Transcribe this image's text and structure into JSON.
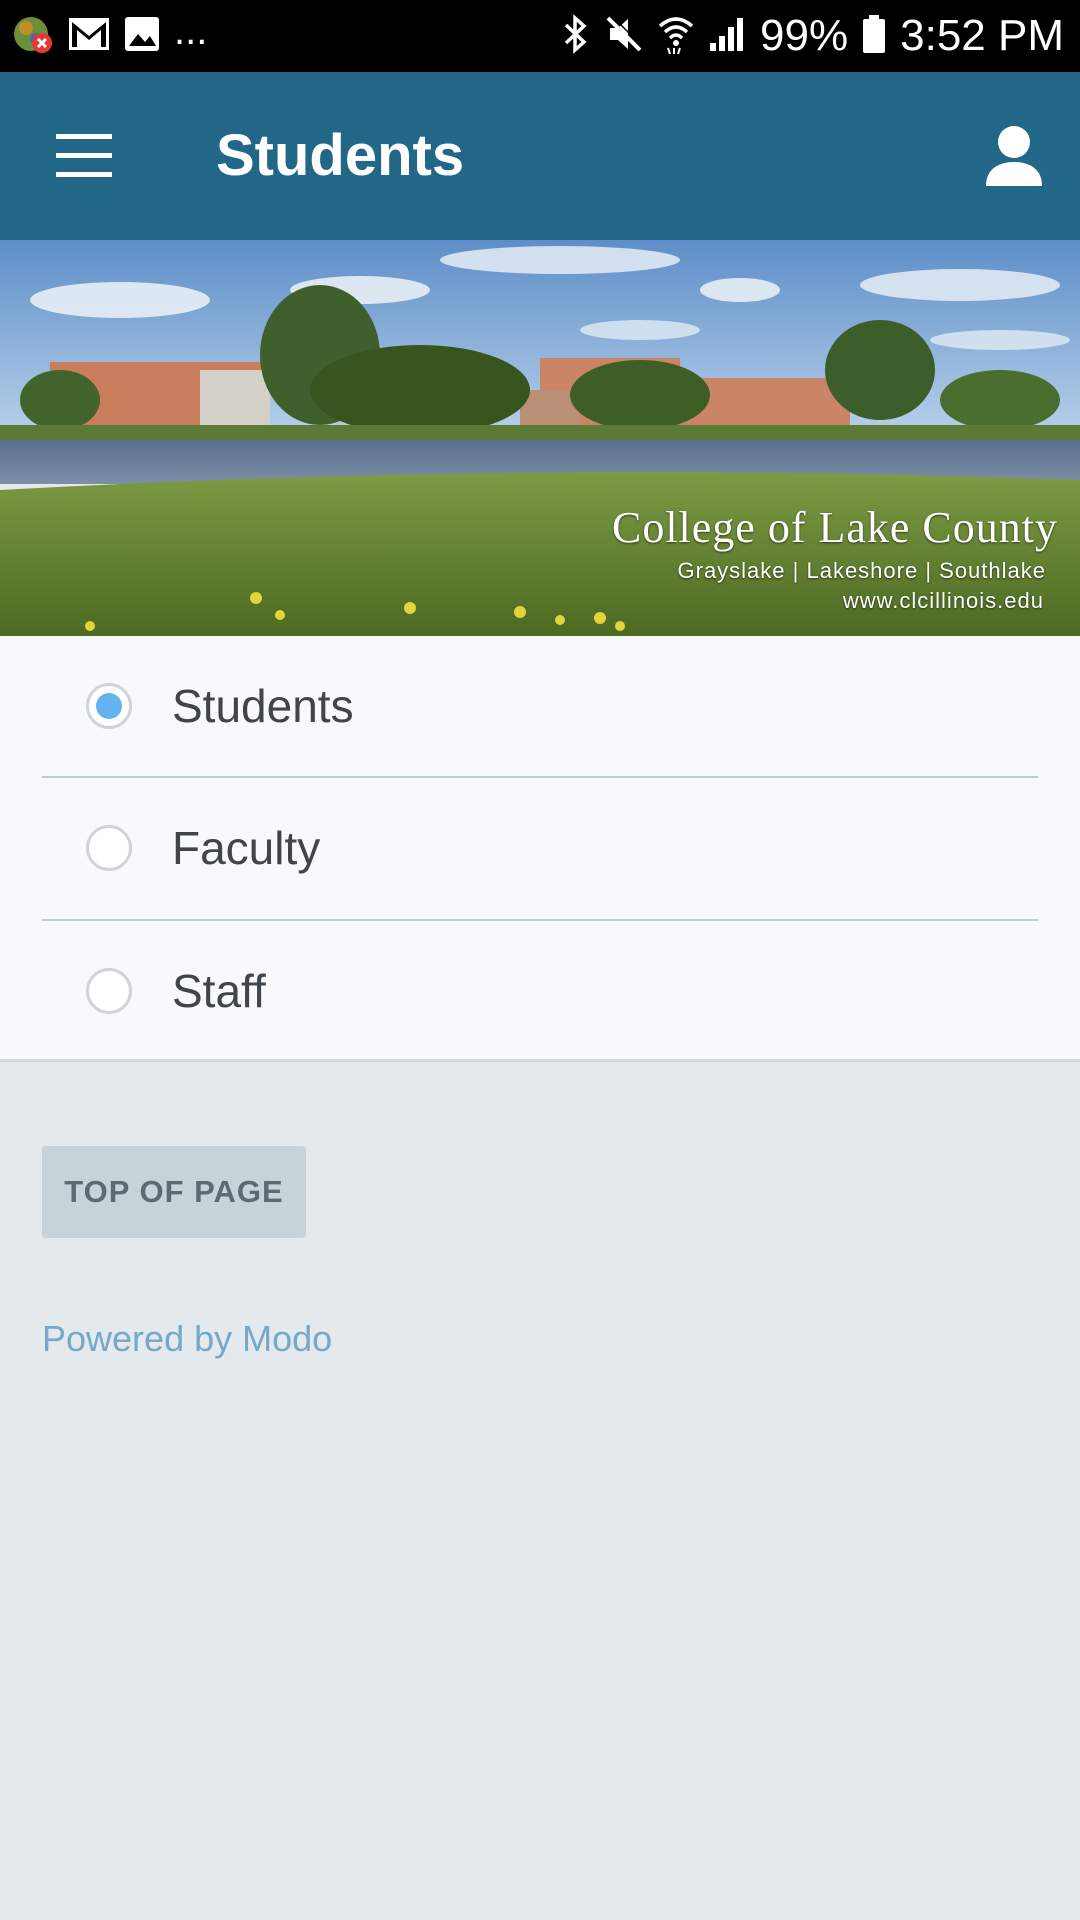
{
  "status_bar": {
    "battery": "99%",
    "time": "3:52 PM",
    "more": "...",
    "icons": [
      "notification-app-icon",
      "gmail-icon",
      "image-icon",
      "bluetooth-icon",
      "mute-icon",
      "wifi-icon",
      "signal-icon",
      "battery-icon"
    ]
  },
  "app_bar": {
    "title": "Students",
    "menu_icon": "hamburger-menu-icon",
    "account_icon": "account-icon",
    "color": "#236788"
  },
  "banner": {
    "title": "College of Lake County",
    "campuses": "Grayslake  |  Lakeshore  |  Southlake",
    "url": "www.clcillinois.edu"
  },
  "audience_options": [
    {
      "label": "Students",
      "selected": true
    },
    {
      "label": "Faculty",
      "selected": false
    },
    {
      "label": "Staff",
      "selected": false
    }
  ],
  "footer": {
    "top_button": "TOP OF PAGE",
    "powered_by": "Powered by Modo"
  },
  "colors": {
    "background": "#e3e9ec",
    "radio_selected": "#64b2ee",
    "link": "#76a9c9"
  }
}
